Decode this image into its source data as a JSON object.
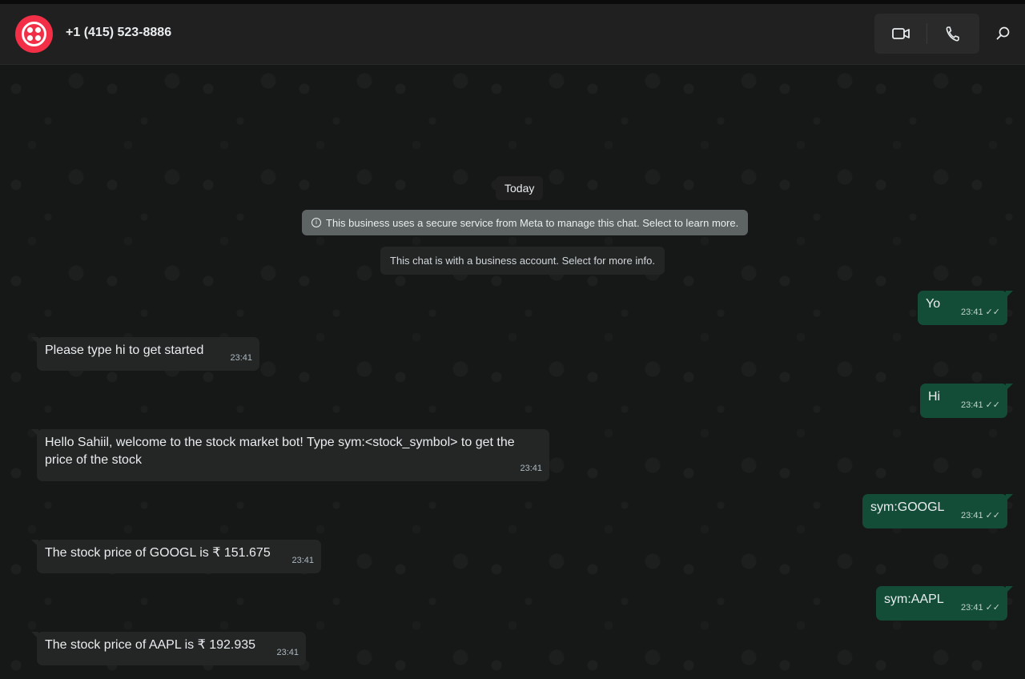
{
  "header": {
    "contact_name": "+1 (415) 523-8886",
    "icons": {
      "video": "video-camera-icon",
      "call": "phone-icon",
      "search": "search-icon"
    },
    "accent": "#f22f46"
  },
  "chat": {
    "date_label": "Today",
    "system_notice": "This business uses a secure service from Meta to manage this chat. Select to learn more.",
    "business_notice": "This chat is with a business account. Select for more info.",
    "messages": [
      {
        "direction": "out",
        "text": "Yo",
        "time": "23:41",
        "status": "read"
      },
      {
        "direction": "in",
        "text": "Please type hi to get started",
        "time": "23:41"
      },
      {
        "direction": "out",
        "text": "Hi",
        "time": "23:41",
        "status": "read"
      },
      {
        "direction": "in",
        "text": "Hello Sahiil, welcome to the stock market bot! Type sym:<stock_symbol> to get the price of the stock",
        "time": "23:41"
      },
      {
        "direction": "out",
        "text": "sym:GOOGL",
        "time": "23:41",
        "status": "read"
      },
      {
        "direction": "in",
        "text": "The stock price of GOOGL is ₹ 151.675",
        "time": "23:41"
      },
      {
        "direction": "out",
        "text": "sym:AAPL",
        "time": "23:41",
        "status": "read"
      },
      {
        "direction": "in",
        "text": "The stock price of AAPL is ₹ 192.935",
        "time": "23:41"
      }
    ]
  },
  "colors": {
    "outgoing_bubble": "#144d37",
    "incoming_bubble": "#242626",
    "background": "#161717"
  }
}
